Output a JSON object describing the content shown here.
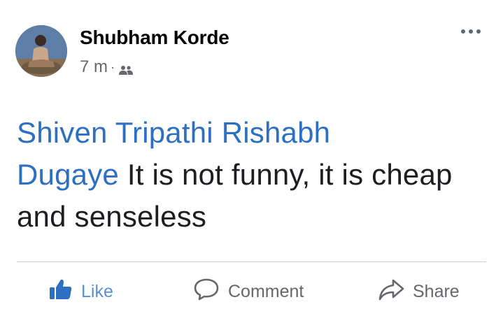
{
  "post": {
    "author": "Shubham Korde",
    "time": "7 m",
    "separator": "·",
    "audience_icon": "friends-icon",
    "body": {
      "mentions": [
        "Shiven Tripathi Rishabh",
        "Dugaye"
      ],
      "text": "It is not funny, it is cheap and senseless"
    }
  },
  "actions": {
    "like": "Like",
    "comment": "Comment",
    "share": "Share"
  },
  "colors": {
    "mention": "#2d6fc1",
    "text": "#1c1e21",
    "muted": "#65676b",
    "like_active": "#2d6fc1"
  }
}
